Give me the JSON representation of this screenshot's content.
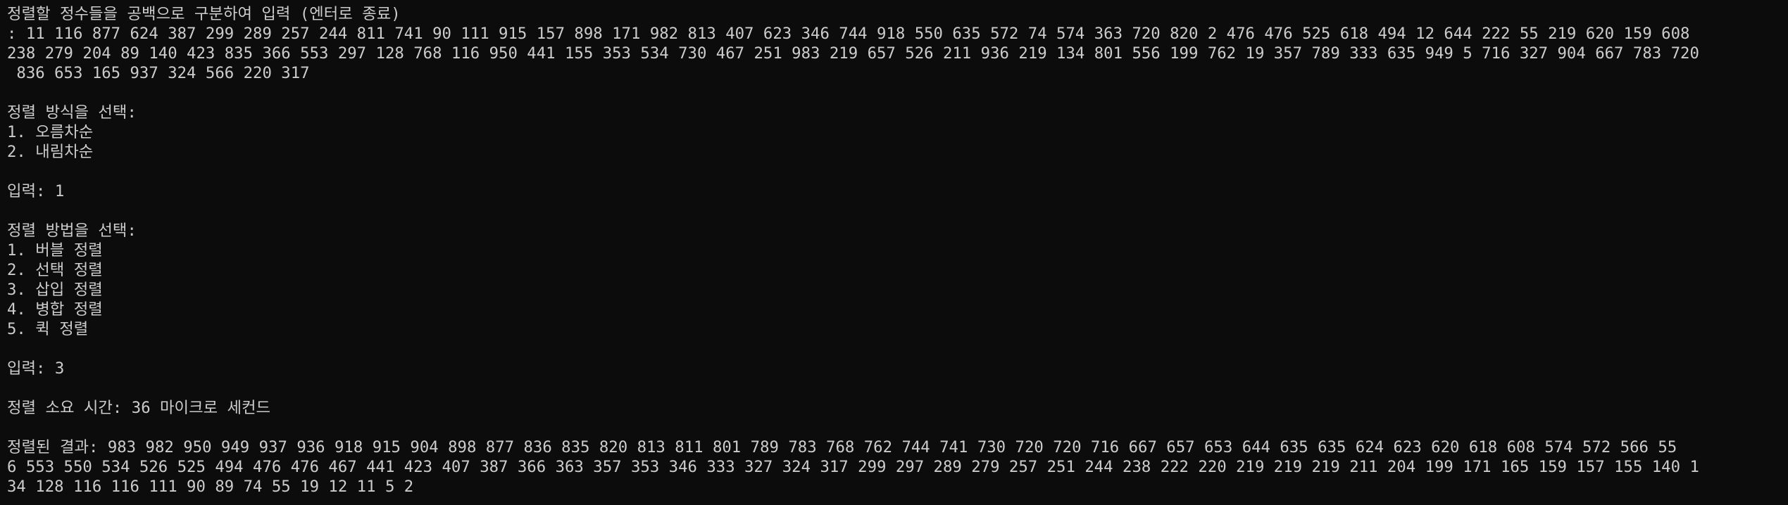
{
  "console": {
    "lines": [
      "정렬할 정수들을 공백으로 구분하여 입력 (엔터로 종료)",
      ": 11 116 877 624 387 299 289 257 244 811 741 90 111 915 157 898 171 982 813 407 623 346 744 918 550 635 572 74 574 363 720 820 2 476 476 525 618 494 12 644 222 55 219 620 159 608",
      "238 279 204 89 140 423 835 366 553 297 128 768 116 950 441 155 353 534 730 467 251 983 219 657 526 211 936 219 134 801 556 199 762 19 357 789 333 635 949 5 716 327 904 667 783 720",
      " 836 653 165 937 324 566 220 317",
      "",
      "정렬 방식을 선택:",
      "1. 오름차순",
      "2. 내림차순",
      "",
      "입력: 1",
      "",
      "정렬 방법을 선택:",
      "1. 버블 정렬",
      "2. 선택 정렬",
      "3. 삽입 정렬",
      "4. 병합 정렬",
      "5. 퀵 정렬",
      "",
      "입력: 3",
      "",
      "정렬 소요 시간: 36 마이크로 세컨드",
      "",
      "정렬된 결과: 983 982 950 949 937 936 918 915 904 898 877 836 835 820 813 811 801 789 783 768 762 744 741 730 720 720 716 667 657 653 644 635 635 624 623 620 618 608 574 572 566 55",
      "6 553 550 534 526 525 494 476 476 467 441 423 407 387 366 363 357 353 346 333 327 324 317 299 297 289 279 257 251 244 238 222 220 219 219 219 211 204 199 171 165 159 157 155 140 1",
      "34 128 116 116 111 90 89 74 55 19 12 11 5 2"
    ]
  }
}
